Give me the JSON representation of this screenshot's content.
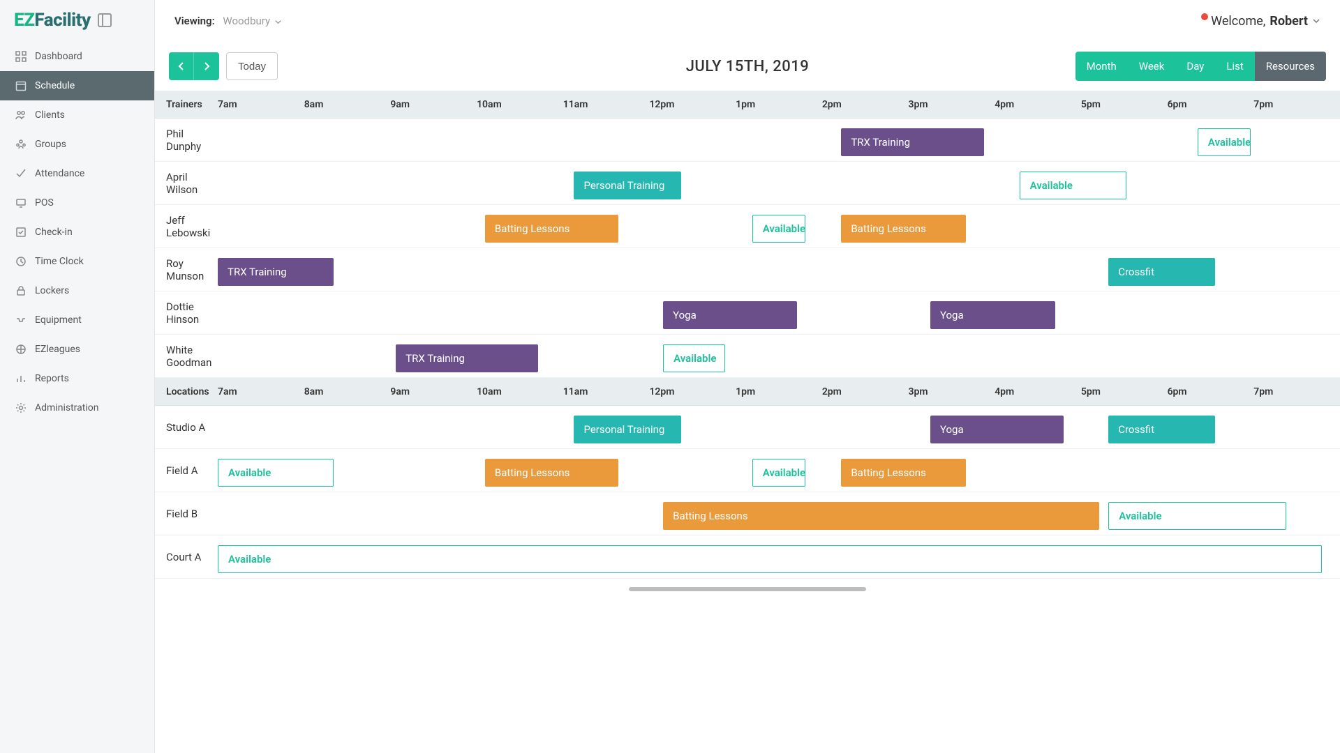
{
  "brand": {
    "ez": "EZ",
    "fac": "Facility"
  },
  "sidebar": {
    "items": [
      {
        "label": "Dashboard"
      },
      {
        "label": "Schedule"
      },
      {
        "label": "Clients"
      },
      {
        "label": "Groups"
      },
      {
        "label": "Attendance"
      },
      {
        "label": "POS"
      },
      {
        "label": "Check-in"
      },
      {
        "label": "Time Clock"
      },
      {
        "label": "Lockers"
      },
      {
        "label": "Equipment"
      },
      {
        "label": "EZleagues"
      },
      {
        "label": "Reports"
      },
      {
        "label": "Administration"
      }
    ]
  },
  "topbar": {
    "viewing_label": "Viewing:",
    "viewing_value": "Woodbury",
    "welcome_prefix": "Welcome, ",
    "user_name": "Robert"
  },
  "toolbar": {
    "today": "Today",
    "date": "JULY 15TH, 2019",
    "views": [
      "Month",
      "Week",
      "Day",
      "List",
      "Resources"
    ]
  },
  "time_labels": [
    "7am",
    "8am",
    "9am",
    "10am",
    "11am",
    "12pm",
    "1pm",
    "2pm",
    "3pm",
    "4pm",
    "5pm",
    "6pm",
    "7pm"
  ],
  "section_headers": {
    "trainers": "Trainers",
    "locations": "Locations"
  },
  "event_types": {
    "trx": "TRX Training",
    "personal": "Personal Training",
    "batting": "Batting Lessons",
    "yoga": "Yoga",
    "crossfit": "Crossfit",
    "available": "Available"
  },
  "trainers": [
    {
      "name": "Phil Dunphy",
      "events": [
        {
          "type": "trx",
          "cls": "ev-purple",
          "start": 2,
          "span": 1.6
        },
        {
          "type": "available",
          "cls": "ev-avail",
          "start": 6,
          "span": 0.6
        }
      ]
    },
    {
      "name": "April Wilson",
      "events": [
        {
          "type": "personal",
          "cls": "ev-teal",
          "start": 11,
          "span": 1.2
        },
        {
          "type": "available",
          "cls": "ev-avail",
          "start": 4,
          "span": 1.2
        }
      ]
    },
    {
      "name": "Jeff Lebowski",
      "events": [
        {
          "type": "batting",
          "cls": "ev-orange",
          "start": 10,
          "span": 1.5
        },
        {
          "type": "available",
          "cls": "ev-avail",
          "start": 1,
          "span": 0.6
        },
        {
          "type": "batting",
          "cls": "ev-orange",
          "start": 2,
          "span": 1.4
        }
      ]
    },
    {
      "name": "Roy Munson",
      "events": [
        {
          "type": "trx",
          "cls": "ev-purple",
          "start": 7,
          "span": 1.3
        },
        {
          "type": "crossfit",
          "cls": "ev-teal",
          "start": 5,
          "span": 1.2
        }
      ]
    },
    {
      "name": "Dottie Hinson",
      "events": [
        {
          "type": "yoga",
          "cls": "ev-purple",
          "start": 12,
          "span": 1.5
        },
        {
          "type": "yoga",
          "cls": "ev-purple",
          "start": 3,
          "span": 1.4
        }
      ]
    },
    {
      "name": "White Goodman",
      "events": [
        {
          "type": "trx",
          "cls": "ev-purple",
          "start": 9,
          "span": 1.6
        },
        {
          "type": "available",
          "cls": "ev-avail",
          "start": 12,
          "span": 0.7
        }
      ]
    }
  ],
  "locations": [
    {
      "name": "Studio A",
      "events": [
        {
          "type": "personal",
          "cls": "ev-teal",
          "start": 11,
          "span": 1.2
        },
        {
          "type": "yoga",
          "cls": "ev-purple",
          "start": 3,
          "span": 1.5
        },
        {
          "type": "crossfit",
          "cls": "ev-teal",
          "start": 5,
          "span": 1.2
        }
      ]
    },
    {
      "name": "Field A",
      "events": [
        {
          "type": "available",
          "cls": "ev-avail",
          "start": 7,
          "span": 1.3
        },
        {
          "type": "batting",
          "cls": "ev-orange",
          "start": 10,
          "span": 1.5
        },
        {
          "type": "available",
          "cls": "ev-avail",
          "start": 1,
          "span": 0.6
        },
        {
          "type": "batting",
          "cls": "ev-orange",
          "start": 2,
          "span": 1.4
        }
      ]
    },
    {
      "name": "Field B",
      "events": [
        {
          "type": "batting",
          "cls": "ev-orange",
          "start": 12,
          "span": 4.9
        },
        {
          "type": "available",
          "cls": "ev-avail",
          "start": 5,
          "span": 2.0
        }
      ]
    },
    {
      "name": "Court A",
      "events": [
        {
          "type": "available",
          "cls": "ev-avail",
          "start": 7,
          "span": 12.4
        }
      ]
    }
  ]
}
